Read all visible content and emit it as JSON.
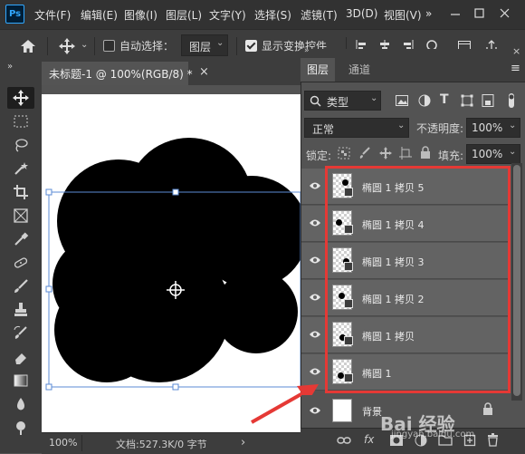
{
  "menubar": {
    "logo": "Ps",
    "items": [
      "文件(F)",
      "编辑(E)",
      "图像(I)",
      "图层(L)",
      "文字(Y)",
      "选择(S)",
      "滤镜(T)",
      "3D(D)",
      "视图(V)"
    ],
    "extra": "»"
  },
  "options": {
    "auto_select_label": "自动选择：",
    "auto_select_checked": false,
    "auto_select_target": "图层",
    "show_transform_label": "显示变换控件",
    "show_transform_checked": true
  },
  "toolbar": {
    "collapse": "»",
    "tools": [
      "move-tool",
      "marquee-tool",
      "lasso-tool",
      "magic-wand-tool",
      "crop-tool",
      "frame-tool",
      "eyedropper-tool",
      "healing-tool",
      "brush-tool",
      "stamp-tool",
      "history-brush-tool",
      "eraser-tool",
      "gradient-tool",
      "blur-tool",
      "dodge-tool"
    ]
  },
  "document": {
    "tab_title": "未标题-1 @ 100%(RGB/8) *",
    "close": "×",
    "zoom": "100%",
    "doc_info": "文档:527.3K/0 字节",
    "nav_arrow": "›"
  },
  "panel": {
    "collapse": "»",
    "close": "×",
    "tabs": [
      "图层",
      "通道"
    ],
    "menu_icon": "≡",
    "filter_kind": "类型",
    "blend_mode": "正常",
    "opacity_label": "不透明度:",
    "opacity_value": "100%",
    "lock_label": "锁定:",
    "fill_label": "填充:",
    "fill_value": "100%",
    "layers": [
      {
        "name": "椭圆 1 拷贝 5",
        "visible": true
      },
      {
        "name": "椭圆 1 拷贝 4",
        "visible": true
      },
      {
        "name": "椭圆 1 拷贝 3",
        "visible": true
      },
      {
        "name": "椭圆 1 拷贝 2",
        "visible": true
      },
      {
        "name": "椭圆 1 拷贝",
        "visible": true
      },
      {
        "name": "椭圆 1",
        "visible": true
      }
    ],
    "background_layer": "背景",
    "footer_icons": [
      "link-icon",
      "fx-icon",
      "mask-icon",
      "adjustment-icon",
      "folder-icon",
      "new-layer-icon",
      "trash-icon"
    ]
  },
  "watermark": {
    "text": "Bai 经验",
    "sub": "jingyan.baidu.com"
  },
  "colors": {
    "accent": "#e53935",
    "ui_dark": "#323232",
    "panel": "#535353",
    "layer_row": "#636363"
  }
}
